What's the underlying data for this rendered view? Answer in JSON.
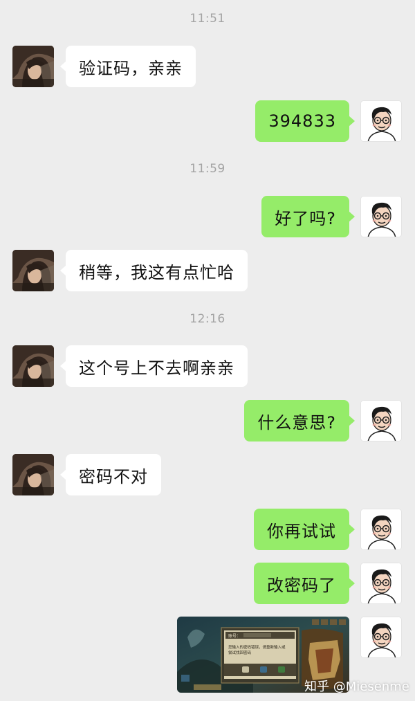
{
  "timestamps": [
    "11:51",
    "11:59",
    "12:16"
  ],
  "messages": [
    {
      "side": "in",
      "text": "验证码，亲亲"
    },
    {
      "side": "out",
      "text": "394833"
    },
    {
      "side": "out",
      "text": "好了吗?"
    },
    {
      "side": "in",
      "text": "稍等，我这有点忙哈"
    },
    {
      "side": "in",
      "text": "这个号上不去啊亲亲"
    },
    {
      "side": "out",
      "text": "什么意思?"
    },
    {
      "side": "in",
      "text": "密码不对"
    },
    {
      "side": "out",
      "text": "你再试试"
    },
    {
      "side": "out",
      "text": "改密码了"
    }
  ],
  "image_message": {
    "dialog_account_label": "账号：",
    "dialog_error_text": "您输入的密码错误，请重新输入或尝试找回密码"
  },
  "watermark": "知乎 @Miesenme",
  "colors": {
    "background": "#ededed",
    "incoming_bubble": "#ffffff",
    "outgoing_bubble": "#95ec69",
    "timestamp": "#a3a3a3"
  }
}
